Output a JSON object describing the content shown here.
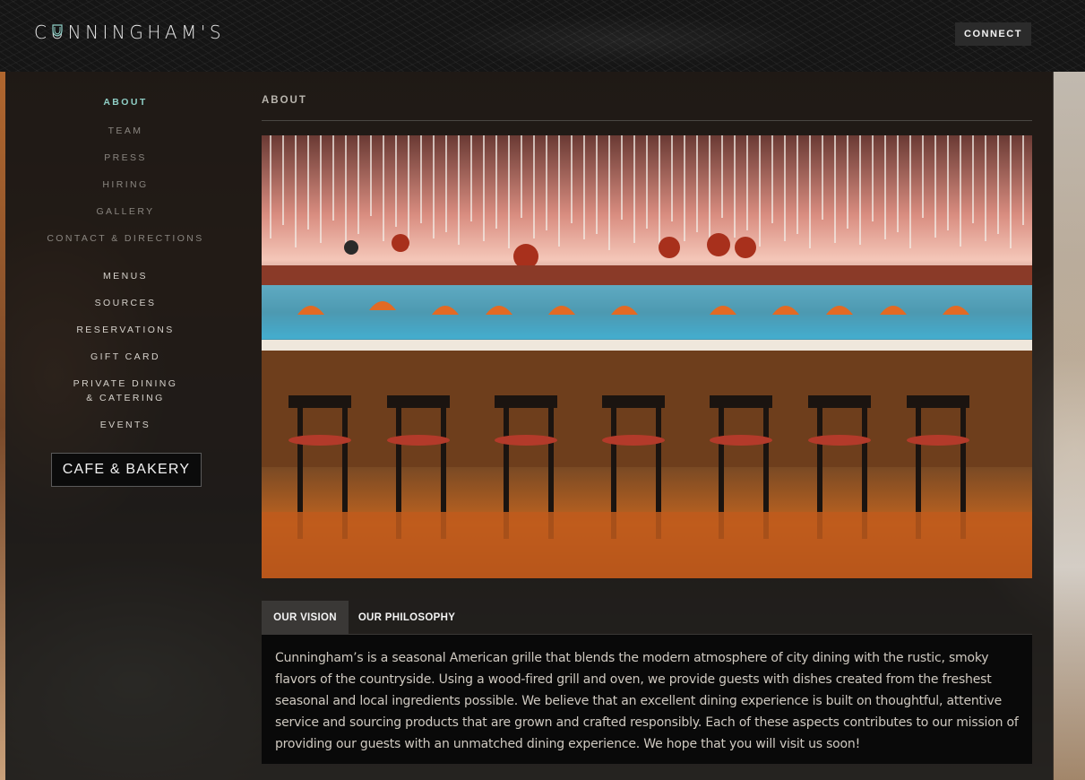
{
  "header": {
    "logo_text": "CUNNINGHAM'S",
    "connect_label": "CONNECT"
  },
  "sidebar": {
    "items": [
      {
        "label": "ABOUT",
        "active": true
      },
      {
        "label": "TEAM"
      },
      {
        "label": "PRESS"
      },
      {
        "label": "HIRING"
      },
      {
        "label": "GALLERY"
      },
      {
        "label": "CONTACT & DIRECTIONS"
      },
      {
        "label": "MENUS"
      },
      {
        "label": "SOURCES"
      },
      {
        "label": "RESERVATIONS"
      },
      {
        "label": "GIFT CARD"
      },
      {
        "label": "PRIVATE DINING & CATERING"
      },
      {
        "label": "EVENTS"
      }
    ],
    "private_dining_line1": "PRIVATE DINING",
    "private_dining_line2": "& CATERING",
    "cafe_button": "CAFE & BAKERY"
  },
  "main": {
    "title": "ABOUT",
    "tabs": [
      {
        "label": "OUR VISION",
        "active": true
      },
      {
        "label": "OUR PHILOSOPHY",
        "active": false
      }
    ],
    "vision_text": "Cunningham’s is a seasonal American grille that blends the modern atmosphere of city dining with the rustic, smoky flavors of the countryside. Using a wood-fired grill and oven, we provide guests with dishes created from the freshest seasonal and local ingredients possible. We believe that an excellent dining experience is built on thoughtful, attentive service and sourcing products that are grown and crafted responsibly. Each of these aspects contributes to our mission of providing our guests with an unmatched dining experience. We hope that you will visit us soon!"
  },
  "colors": {
    "accent": "#8fcfc6",
    "header_bg": "#151515",
    "button_bg": "#2b2b2b"
  }
}
